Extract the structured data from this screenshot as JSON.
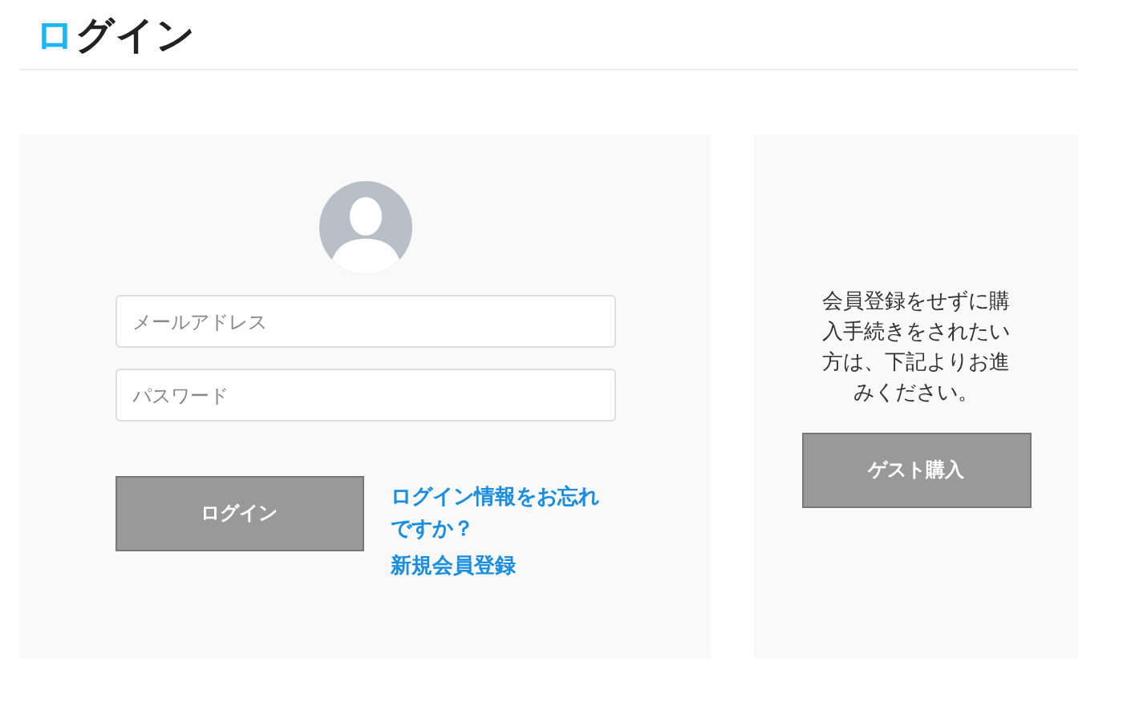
{
  "page": {
    "title": "ログイン"
  },
  "login": {
    "email": {
      "placeholder": "メールアドレス"
    },
    "password": {
      "placeholder": "パスワード"
    },
    "button": "ログイン",
    "links": [
      "ログイン情報をお忘れですか？",
      "新規会員登録"
    ]
  },
  "guest": {
    "message": "会員登録をせずに購入手続きをされたい方は、下記よりお進みください。",
    "button": "ゲスト購入"
  }
}
